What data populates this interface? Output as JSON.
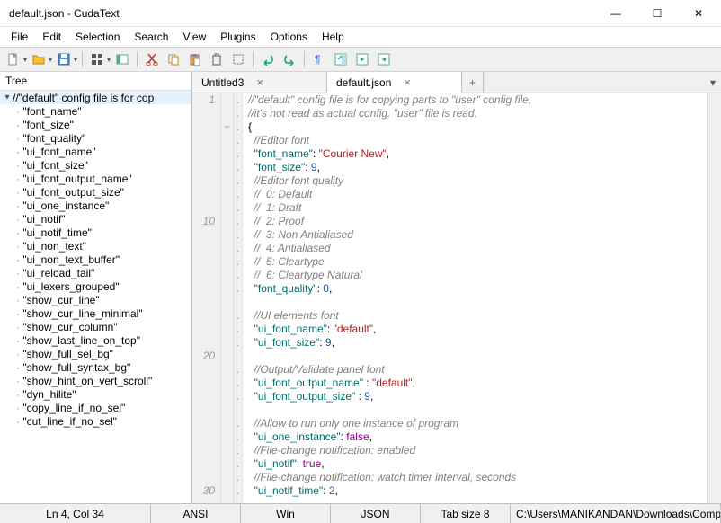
{
  "window": {
    "title": "default.json - CudaText",
    "min": "—",
    "max": "☐",
    "close": "✕"
  },
  "menu": [
    "File",
    "Edit",
    "Selection",
    "Search",
    "View",
    "Plugins",
    "Options",
    "Help"
  ],
  "tree": {
    "header": "Tree",
    "root": "//\"default\" config file is for cop",
    "items": [
      "\"font_name\"",
      "\"font_size\"",
      "\"font_quality\"",
      "\"ui_font_name\"",
      "\"ui_font_size\"",
      "\"ui_font_output_name\"",
      "\"ui_font_output_size\"",
      "\"ui_one_instance\"",
      "\"ui_notif\"",
      "\"ui_notif_time\"",
      "\"ui_non_text\"",
      "\"ui_non_text_buffer\"",
      "\"ui_reload_tail\"",
      "\"ui_lexers_grouped\"",
      "\"show_cur_line\"",
      "\"show_cur_line_minimal\"",
      "\"show_cur_column\"",
      "\"show_last_line_on_top\"",
      "\"show_full_sel_bg\"",
      "\"show_full_syntax_bg\"",
      "\"show_hint_on_vert_scroll\"",
      "\"dyn_hilite\"",
      "\"copy_line_if_no_sel\"",
      "\"cut_line_if_no_sel\""
    ]
  },
  "tabs": {
    "items": [
      {
        "label": "Untitled3",
        "active": false
      },
      {
        "label": "default.json",
        "active": true
      }
    ],
    "plus": "+"
  },
  "code": {
    "lines": [
      {
        "n": "1",
        "f": " ",
        "m": ".",
        "html": "<span class='c-cmt'>//\"default\" config file is for copying parts to \"user\" config file,</span>"
      },
      {
        "n": "",
        "f": " ",
        "m": ".",
        "html": "<span class='c-cmt'>//it's not read as actual config. \"user\" file is read.</span>"
      },
      {
        "n": "",
        "f": "−",
        "m": ".",
        "html": "<span class='c-pun'>{</span>"
      },
      {
        "n": "",
        "f": " ",
        "m": ".",
        "html": "  <span class='c-cmt'>//Editor font</span>"
      },
      {
        "n": "",
        "f": " ",
        "m": ".",
        "html": "  <span class='c-key'>\"font_name\"</span><span class='c-pun'>: </span><span class='c-str'>\"Courier New\"</span><span class='c-pun'>,</span>"
      },
      {
        "n": "",
        "f": " ",
        "m": ".",
        "html": "  <span class='c-key'>\"font_size\"</span><span class='c-pun'>: </span><span class='c-num'>9</span><span class='c-pun'>,</span>"
      },
      {
        "n": "",
        "f": " ",
        "m": ".",
        "html": "  <span class='c-cmt'>//Editor font quality</span>"
      },
      {
        "n": "",
        "f": " ",
        "m": ".",
        "html": "  <span class='c-cmt'>//  0: Default</span>"
      },
      {
        "n": "",
        "f": " ",
        "m": ".",
        "html": "  <span class='c-cmt'>//  1: Draft</span>"
      },
      {
        "n": "10",
        "f": " ",
        "m": ".",
        "html": "  <span class='c-cmt'>//  2: Proof</span>"
      },
      {
        "n": "",
        "f": " ",
        "m": ".",
        "html": "  <span class='c-cmt'>//  3: Non Antialiased</span>"
      },
      {
        "n": "",
        "f": " ",
        "m": ".",
        "html": "  <span class='c-cmt'>//  4: Antialiased</span>"
      },
      {
        "n": "",
        "f": " ",
        "m": ".",
        "html": "  <span class='c-cmt'>//  5: Cleartype</span>"
      },
      {
        "n": "",
        "f": " ",
        "m": ".",
        "html": "  <span class='c-cmt'>//  6: Cleartype Natural</span>"
      },
      {
        "n": "",
        "f": " ",
        "m": ".",
        "html": "  <span class='c-key'>\"font_quality\"</span><span class='c-pun'>: </span><span class='c-num'>0</span><span class='c-pun'>,</span>"
      },
      {
        "n": "",
        "f": " ",
        "m": " ",
        "html": ""
      },
      {
        "n": "",
        "f": " ",
        "m": ".",
        "html": "  <span class='c-cmt'>//UI elements font</span>"
      },
      {
        "n": "",
        "f": " ",
        "m": ".",
        "html": "  <span class='c-key'>\"ui_font_name\"</span><span class='c-pun'>: </span><span class='c-str'>\"default\"</span><span class='c-pun'>,</span>"
      },
      {
        "n": "",
        "f": " ",
        "m": ".",
        "html": "  <span class='c-key'>\"ui_font_size\"</span><span class='c-pun'>: </span><span class='c-num'>9</span><span class='c-pun'>,</span>"
      },
      {
        "n": "20",
        "f": " ",
        "m": " ",
        "html": ""
      },
      {
        "n": "",
        "f": " ",
        "m": ".",
        "html": "  <span class='c-cmt'>//Output/Validate panel font</span>"
      },
      {
        "n": "",
        "f": " ",
        "m": ".",
        "html": "  <span class='c-key'>\"ui_font_output_name\"</span> <span class='c-pun'>: </span><span class='c-str'>\"default\"</span><span class='c-pun'>,</span>"
      },
      {
        "n": "",
        "f": " ",
        "m": ".",
        "html": "  <span class='c-key'>\"ui_font_output_size\"</span> <span class='c-pun'>: </span><span class='c-num'>9</span><span class='c-pun'>,</span>"
      },
      {
        "n": "",
        "f": " ",
        "m": " ",
        "html": ""
      },
      {
        "n": "",
        "f": " ",
        "m": ".",
        "html": "  <span class='c-cmt'>//Allow to run only one instance of program</span>"
      },
      {
        "n": "",
        "f": " ",
        "m": ".",
        "html": "  <span class='c-key'>\"ui_one_instance\"</span><span class='c-pun'>: </span><span class='c-kw'>false</span><span class='c-pun'>,</span>"
      },
      {
        "n": "",
        "f": " ",
        "m": ".",
        "html": "  <span class='c-cmt'>//File-change notification: enabled</span>"
      },
      {
        "n": "",
        "f": " ",
        "m": ".",
        "html": "  <span class='c-key'>\"ui_notif\"</span><span class='c-pun'>: </span><span class='c-kw'>true</span><span class='c-pun'>,</span>"
      },
      {
        "n": "",
        "f": " ",
        "m": ".",
        "html": "  <span class='c-cmt'>//File-change notification: watch timer interval, seconds</span>"
      },
      {
        "n": "30",
        "f": " ",
        "m": ".",
        "html": "  <span class='c-key'>\"ui_notif_time\"</span><span class='c-pun'>: </span><span class='c-num'>2</span><span class='c-pun'>,</span>"
      }
    ]
  },
  "status": {
    "pos": "Ln 4, Col 34",
    "enc": "ANSI",
    "eol": "Win",
    "lexer": "JSON",
    "tab": "Tab size 8",
    "path": "C:\\Users\\MANIKANDAN\\Downloads\\Compres"
  }
}
